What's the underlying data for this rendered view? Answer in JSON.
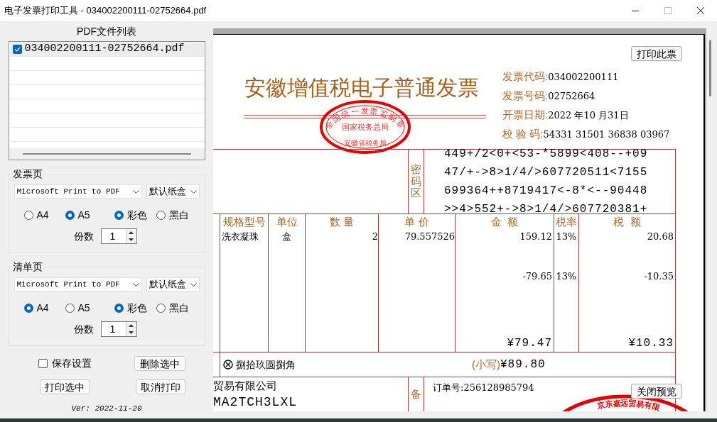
{
  "window": {
    "title": "电子发票打印工具  -  034002200111-02752664.pdf"
  },
  "file_list": {
    "title": "PDF文件列表",
    "items": [
      {
        "name": "034002200111-02752664.pdf",
        "checked": true,
        "selected": true
      }
    ]
  },
  "groups": [
    {
      "label": "发票页",
      "printer": "Microsoft Print to PDF",
      "tray": "默认纸盒",
      "paper": [
        {
          "label": "A4",
          "selected": false
        },
        {
          "label": "A5",
          "selected": true
        }
      ],
      "color_mode": [
        {
          "label": "彩色",
          "selected": true
        },
        {
          "label": "黑白",
          "selected": false
        }
      ],
      "copies_label": "份数",
      "copies": "1"
    },
    {
      "label": "清单页",
      "printer": "Microsoft Print to PDF",
      "tray": "默认纸盒",
      "paper": [
        {
          "label": "A4",
          "selected": true
        },
        {
          "label": "A5",
          "selected": false
        }
      ],
      "color_mode": [
        {
          "label": "彩色",
          "selected": true
        },
        {
          "label": "黑白",
          "selected": false
        }
      ],
      "copies_label": "份数",
      "copies": "1"
    }
  ],
  "save_settings": {
    "label": "保存设置",
    "checked": false
  },
  "buttons": {
    "delete": "删除选中",
    "print": "打印选中",
    "cancel": "取消打印"
  },
  "version": "Ver: 2022-11-20",
  "preview": {
    "print_button": "打印此票",
    "close_button": "关闭预览",
    "invoice": {
      "title": "安徽增值税电子普通发票",
      "seal": {
        "arc": "全国统一发票监制章",
        "middle": "国家税务总局",
        "bottom": "安徽省税务局"
      },
      "fields": [
        {
          "label": "发票代码:",
          "value": "034002200111"
        },
        {
          "label": "发票号码:",
          "value": "02752664"
        },
        {
          "label": "开票日期:",
          "value": " 2022 年10 月31日"
        },
        {
          "label": "校 验 码:",
          "value": "54331 31501 36838 03967"
        }
      ],
      "cipher_label": "密码区",
      "cipher_lines": [
        "449+/2<0+<53-*5899<408--+09",
        "47/+->8>1/4/>607720511<7155",
        "699364++8719417<-8*<--90448",
        ">>4>552+->8>1/4/>607720381+"
      ],
      "columns": [
        "规格型号",
        "单位",
        "数 量",
        "单 价",
        "金  额",
        "税率",
        "税  额"
      ],
      "rows": [
        {
          "spec": "洗衣凝珠",
          "unit": "盒",
          "qty": "2",
          "price": "79.557526",
          "amount": "159.12",
          "rate": "13%",
          "tax": "20.68"
        },
        {
          "amount": "-79.65",
          "rate": "13%",
          "tax": "-10.35"
        }
      ],
      "total_amount": "¥79.47",
      "total_tax": "¥10.33",
      "total_words": "捌拾玖圆捌角",
      "small_label": "(小写)",
      "total": "¥89.80",
      "seller_lines": [
        "贸易有限公司",
        "MA2TCH3LXL"
      ],
      "remarks_label": "备",
      "remark": "订单号:256128985794",
      "seller_seal": "京东嘉远贸易有限"
    }
  }
}
